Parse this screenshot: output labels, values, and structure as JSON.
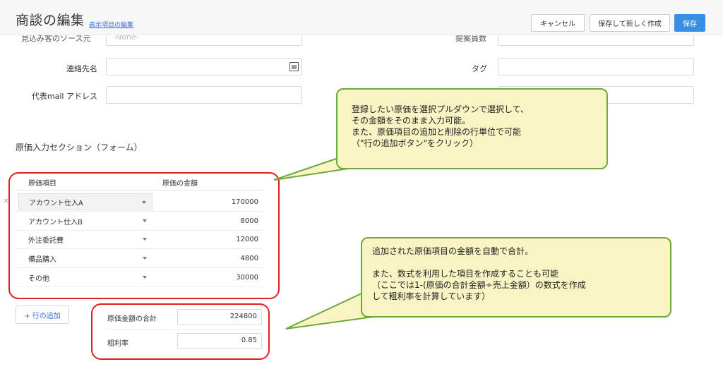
{
  "header": {
    "title": "商談の編集",
    "edit_fields_link": "表示項目の編集",
    "buttons": {
      "cancel": "キャンセル",
      "save_new": "保存して新しく作成",
      "save": "保存"
    }
  },
  "form": {
    "cut_left_label": "見込み客のソース元",
    "cut_left_placeholder": "-None-",
    "cut_right_label": "提案員数",
    "contact_label": "連絡先名",
    "tag_label": "タグ",
    "email_label": "代表mail アドレス"
  },
  "cost_section": {
    "title": "原価入力セクション（フォーム）",
    "columns": {
      "item": "原価項目",
      "amount": "原価の金額"
    },
    "rows": [
      {
        "item": "アカウント仕入A",
        "amount": "170000"
      },
      {
        "item": "アカウント仕入B",
        "amount": "8000"
      },
      {
        "item": "外注委託費",
        "amount": "12000"
      },
      {
        "item": "備品購入",
        "amount": "4800"
      },
      {
        "item": "その他",
        "amount": "30000"
      }
    ],
    "add_row_label": "+ 行の追加",
    "total_label": "原価金額の合計",
    "total_value": "224800",
    "margin_label": "粗利率",
    "margin_value": "0.85"
  },
  "callouts": {
    "top": "登録したい原価を選択プルダウンで選択して、\nその金額をそのまま入力可能。\nまた、原価項目の追加と削除の行単位で可能\n（\"行の追加ボタン\"をクリック）",
    "bottom": "追加された原価項目の金額を自動で合計。\n\nまた、数式を利用した項目を作成することも可能\n（ここでは1-(原価の合計金額÷売上金額）の数式を作成\nして粗利率を計算しています）"
  },
  "colors": {
    "accent": "#3a8ee6",
    "highlight": "#e02020",
    "callout_bg": "#f9f4c4",
    "callout_border": "#6fa83a"
  }
}
